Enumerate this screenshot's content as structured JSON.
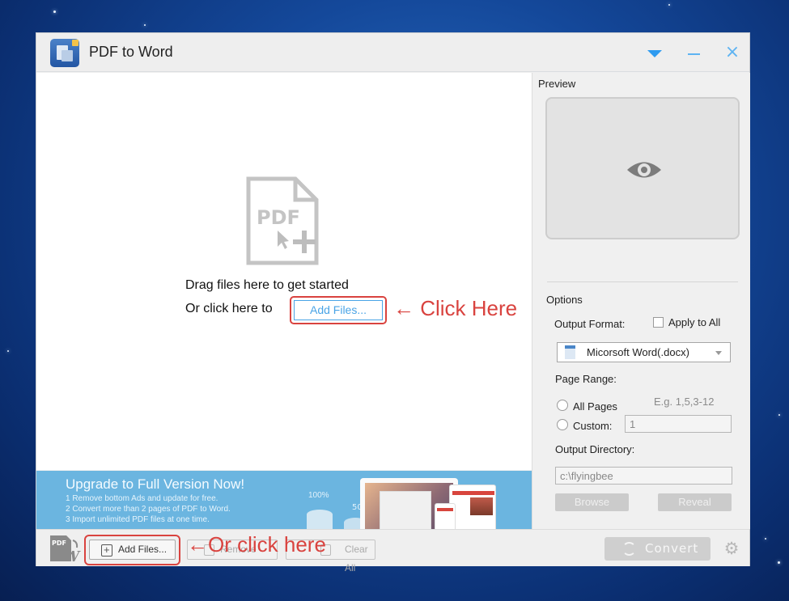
{
  "window": {
    "title": "PDF to Word",
    "controls": {
      "menu": "dropdown-menu",
      "minimize": "minimize",
      "close": "×"
    }
  },
  "dropzone": {
    "icon_label": "PDF",
    "drag_text": "Drag files here to get started",
    "click_text": "Or click here to",
    "add_files_label": "Add Files...",
    "annotation": "← Click Here"
  },
  "banner": {
    "title": "Upgrade to Full Version Now!",
    "lines": [
      "1 Remove bottom Ads and update for free.",
      "2 Convert more than 2 pages of PDF to Word.",
      "3 Import unlimited PDF files at one time."
    ],
    "pct1": "100%",
    "pct2": "50"
  },
  "toolbar": {
    "add_files_label": "Add Files...",
    "remove_label": "Remove",
    "clear_all_label": "Clear All",
    "annotation": "←Or click here",
    "convert_label": "Convert"
  },
  "side": {
    "preview_label": "Preview",
    "options_label": "Options",
    "output_format_label": "Output Format:",
    "apply_to_all_label": "Apply to All",
    "apply_to_all_checked": false,
    "format_selected": "Micorsoft Word(.docx)",
    "page_range_label": "Page Range:",
    "all_pages_label": "All Pages",
    "custom_label": "Custom:",
    "range_hint": "E.g. 1,5,3-12",
    "custom_value": "1",
    "output_directory_label": "Output Directory:",
    "output_directory_value": "c:\\flyingbee",
    "browse_label": "Browse",
    "reveal_label": "Reveal"
  },
  "colors": {
    "accent": "#2e9bf0",
    "annotation_red": "#d9433f",
    "banner_blue": "#6bb5e0"
  }
}
